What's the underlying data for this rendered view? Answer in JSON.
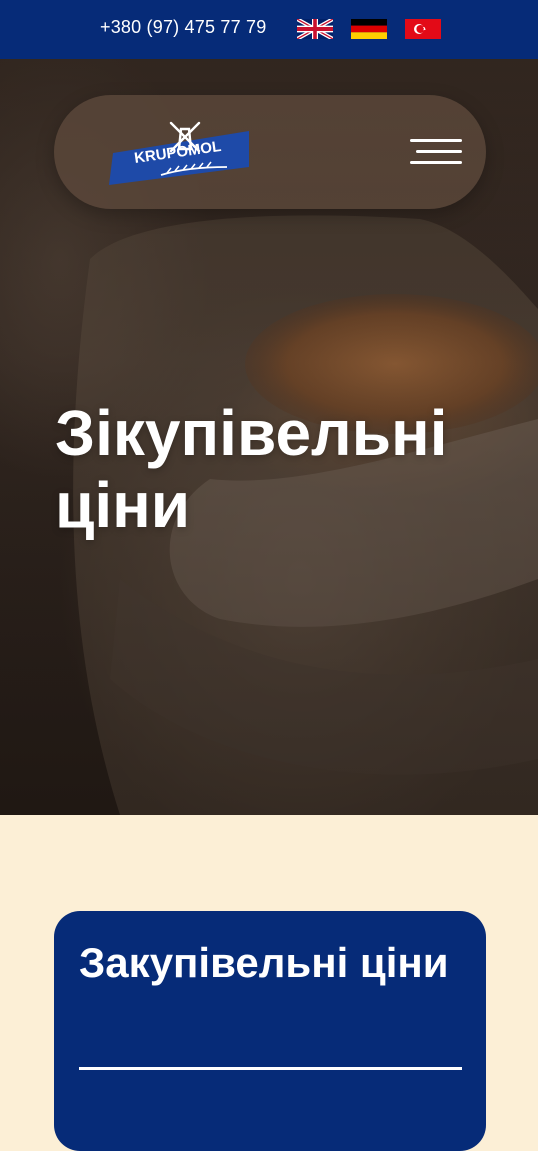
{
  "topbar": {
    "phone": "+380 (97) 475 77 79",
    "languages": [
      {
        "code": "en",
        "icon": "uk-flag-icon"
      },
      {
        "code": "de",
        "icon": "germany-flag-icon"
      },
      {
        "code": "tr",
        "icon": "turkey-flag-icon"
      }
    ]
  },
  "header": {
    "logo_text": "KRUPOMOL",
    "menu_icon": "hamburger-menu-icon"
  },
  "hero": {
    "title": "Зікупівельні ціни"
  },
  "card": {
    "title": "Закупівельні ціни"
  },
  "colors": {
    "brand_blue": "#062b78",
    "page_cream": "#fcefd6",
    "white": "#ffffff"
  }
}
